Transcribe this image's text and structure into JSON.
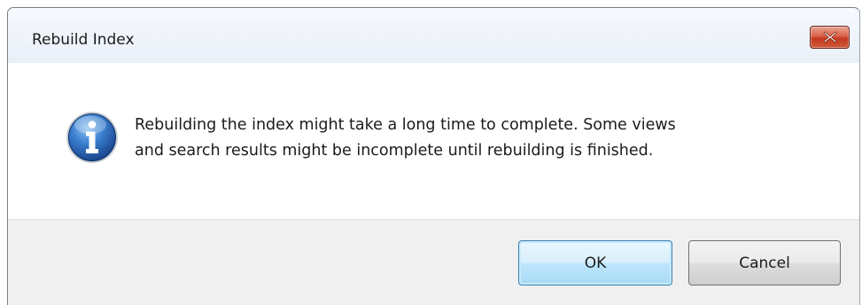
{
  "window": {
    "title": "Rebuild Index",
    "close_icon": "close-icon"
  },
  "message": {
    "icon": "info-icon",
    "line1": "Rebuilding the index might take a long time to complete. Some views",
    "line2": "and search results might be incomplete until rebuilding is finished."
  },
  "buttons": {
    "ok_label": "OK",
    "cancel_label": "Cancel"
  },
  "colors": {
    "close_button": "#c5381e",
    "info_icon": "#1f5fa8",
    "default_button_border": "#3c7fb1"
  }
}
